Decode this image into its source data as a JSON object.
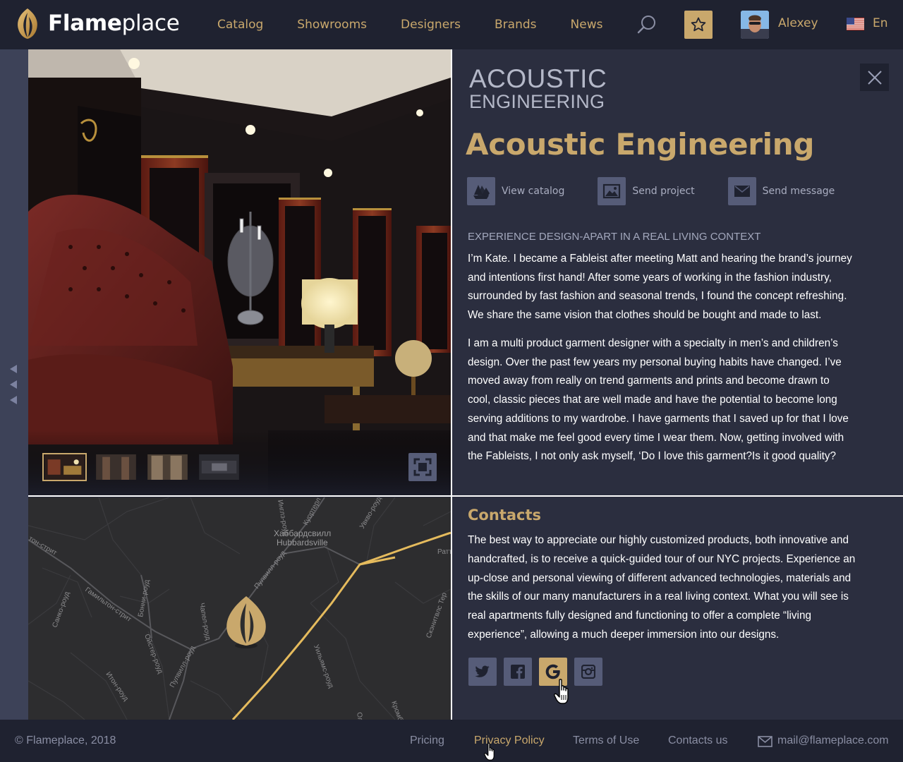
{
  "header": {
    "logo_bold": "Flame",
    "logo_light": "place",
    "nav": [
      "Catalog",
      "Showrooms",
      "Designers",
      "Brands",
      "News"
    ],
    "user_name": "Alexey",
    "language": "En"
  },
  "gallery": {
    "thumbnail_count": 4,
    "active_thumbnail": 1
  },
  "brand": {
    "logo_line1": "ACOUSTIC",
    "logo_line2": "ENGINEERING",
    "title": "Acoustic Engineering",
    "actions": [
      {
        "label": "View catalog",
        "icon": "catalog-swatches-icon"
      },
      {
        "label": "Send project",
        "icon": "image-icon"
      },
      {
        "label": "Send message",
        "icon": "envelope-icon"
      }
    ],
    "section_tag": "EXPERIENCE DESIGN-APART IN A REAL LIVING CONTEXT",
    "paragraph1_lines": [
      "I’m Kate. I became a Fableist after meeting Matt and hearing the brand’s journey",
      "and intentions first hand! After some years of working in the fashion industry,",
      "surrounded by fast fashion and seasonal trends, I found the concept refreshing.",
      "We share the same vision that clothes should be bought and made to last."
    ],
    "paragraph2_lines": [
      "I am a multi product garment designer with a specialty in men’s and children’s",
      "design. Over the past few years my personal buying habits have changed. I’ve",
      "moved away from really on trend garments and prints and become drawn to",
      "cool, classic pieces that are well made and have the potential to become long",
      "serving additions to my wardrobe. I have garments that I saved up for that I love",
      "and that make me feel good every time I wear them. Now, getting involved with",
      "the Fableists, I not only ask myself, ‘Do I love this garment?Is it good quality?"
    ]
  },
  "map": {
    "labels": {
      "district_ru": "Хаббардсвилл",
      "district_en": "Hubbardsville",
      "street1": "Гамильтон-стрит",
      "street2": "Пулвилл-роуд",
      "street3": "Пулвилл-роуд",
      "street4": "Бонни-роуд",
      "street5": "Чапел-роуд",
      "street6": "Ойстер-роуд",
      "street7": "Итон-роуд",
      "street8": "Санко-роуд",
      "street9": "Куортерл",
      "street10": "Увкво-роуд",
      "street11": "Уильямс-роуд",
      "street12": "Скэнитвлс Тер",
      "street13": "Кромб",
      "street14": "Ратт",
      "street15": "тон-стрит",
      "street16": "Инглз-роуд",
      "street17": "Ол"
    }
  },
  "contacts": {
    "title": "Contacts",
    "lines": [
      "The best way to appreciate our highly customized products, both innovative and",
      "handcrafted, is to receive a quick-guided tour of our NYC projects. Experience an",
      "up-close and personal viewing of different advanced technologies, materials and",
      "the skills of our many manufacturers in a real living context. What you will see is",
      "real apartments fully designed and functioning to offer a complete “living",
      "experience”, allowing a much deeper immersion into our designs."
    ],
    "socials": [
      "twitter-icon",
      "facebook-icon",
      "google-icon",
      "instagram-icon"
    ],
    "active_social": "google-icon"
  },
  "footer": {
    "copyright": "© Flameplace, 2018",
    "links": [
      "Pricing",
      "Privacy Policy",
      "Terms of Use",
      "Contacts us"
    ],
    "email": "mail@flameplace.com"
  },
  "colors": {
    "accent": "#c9a86c",
    "header_bg": "#1f2230",
    "panel_bg": "#2b2e3f",
    "button_bg": "#565c78"
  }
}
